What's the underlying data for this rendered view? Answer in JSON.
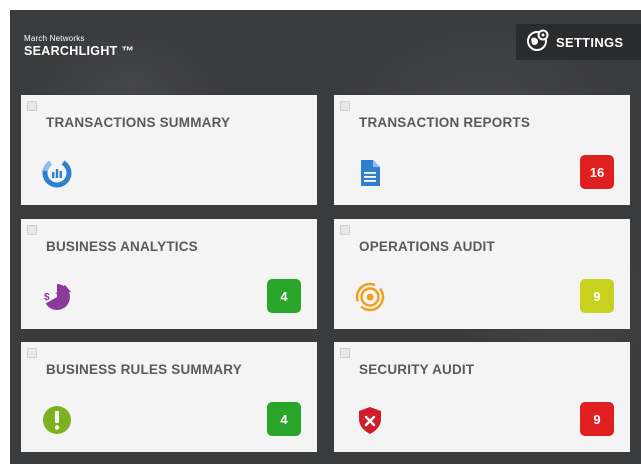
{
  "header": {
    "company": "March Networks",
    "product": "SEARCHLIGHT ™",
    "settings_label": "SETTINGS"
  },
  "tiles": [
    {
      "title": "TRANSACTIONS SUMMARY",
      "icon": "donut-chart-icon",
      "badge": null
    },
    {
      "title": "TRANSACTION REPORTS",
      "icon": "document-icon",
      "badge": "16",
      "badge_color": "#e02020"
    },
    {
      "title": "BUSINESS ANALYTICS",
      "icon": "pie-dollar-icon",
      "badge": "4",
      "badge_color": "#2aa52a"
    },
    {
      "title": "OPERATIONS AUDIT",
      "icon": "target-radar-icon",
      "badge": "9",
      "badge_color": "#c8d21e"
    },
    {
      "title": "BUSINESS RULES SUMMARY",
      "icon": "exclamation-icon",
      "badge": "4",
      "badge_color": "#2aa52a"
    },
    {
      "title": "SECURITY AUDIT",
      "icon": "shield-x-icon",
      "badge": "9",
      "badge_color": "#e02020"
    }
  ],
  "colors": {
    "background": "#3a3b3d",
    "tile": "#f4f4f4",
    "badge_red": "#e02020",
    "badge_green": "#2aa52a",
    "badge_yellow": "#c8d21e"
  }
}
